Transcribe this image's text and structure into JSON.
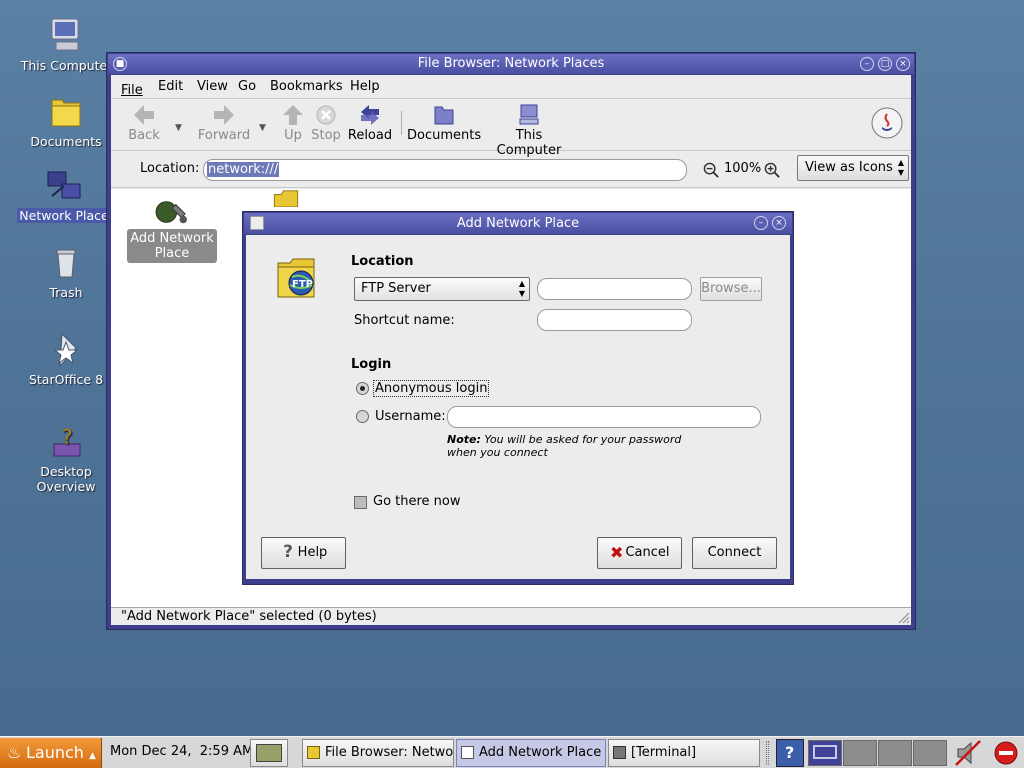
{
  "desktop": {
    "icons": [
      {
        "label": "This Compute"
      },
      {
        "label": "Documents"
      },
      {
        "label": "Network Place"
      },
      {
        "label": "Trash"
      },
      {
        "label": "StarOffice 8"
      },
      {
        "label": "Desktop Overview"
      }
    ]
  },
  "window": {
    "title": "File Browser: Network Places",
    "menu": [
      "File",
      "Edit",
      "View",
      "Go",
      "Bookmarks",
      "Help"
    ],
    "toolbar": {
      "back": "Back",
      "forward": "Forward",
      "up": "Up",
      "stop": "Stop",
      "reload": "Reload",
      "documents": "Documents",
      "this_computer": "This Computer"
    },
    "location_label": "Location:",
    "location_value": "network:///",
    "zoom": "100%",
    "view_mode": "View as Icons",
    "items": [
      {
        "label": "Add Network Place"
      }
    ],
    "status": "\"Add Network Place\" selected (0 bytes)"
  },
  "dialog": {
    "title": "Add Network Place",
    "location_heading": "Location",
    "server_type": "FTP Server",
    "location_value": "",
    "browse_label": "Browse...",
    "shortcut_label": "Shortcut name:",
    "shortcut_value": "",
    "login_heading": "Login",
    "anonymous_label": "Anonymous login",
    "anonymous_selected": true,
    "username_label": "Username:",
    "username_value": "",
    "note_bold": "Note:",
    "note_text1": " You will be asked for your password",
    "note_text2": "when you connect",
    "go_there_label": "Go there now",
    "go_there_checked": false,
    "help_label": "Help",
    "cancel_label": "Cancel",
    "connect_label": "Connect"
  },
  "taskbar": {
    "launch_label": "Launch",
    "clock": "Mon Dec 24,  2:59 AM",
    "tasks": [
      {
        "label": "File Browser: Network"
      },
      {
        "label": "Add Network Place"
      },
      {
        "label": "[Terminal]"
      }
    ]
  },
  "colors": {
    "titlebar": "#4b4fa0",
    "desktop": "#4f7498",
    "launch": "#d2690e",
    "selection": "#6c7ab8"
  }
}
